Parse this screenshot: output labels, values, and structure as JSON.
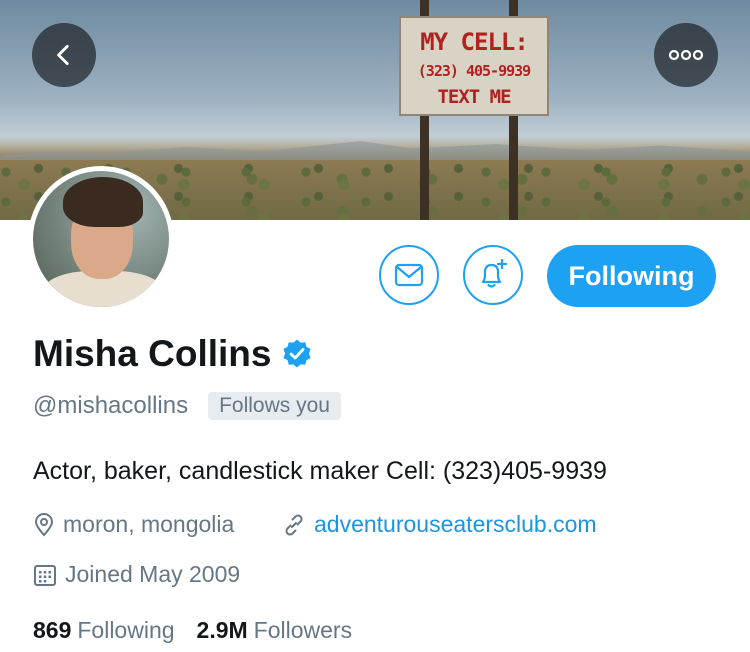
{
  "banner": {
    "sign_line1": "MY CELL:",
    "sign_line2": "(323) 405-9939",
    "sign_line3": "TEXT ME"
  },
  "header": {
    "back_icon": "chevron-left-icon",
    "more_icon": "more-horizontal-icon"
  },
  "actions": {
    "message_icon": "envelope-icon",
    "notify_icon": "bell-plus-icon",
    "following_label": "Following"
  },
  "profile": {
    "name": "Misha Collins",
    "handle": "@mishacollins",
    "follows_you": "Follows you",
    "bio": "Actor, baker, candlestick maker Cell: (323)405-9939",
    "location": "moron, mongolia",
    "website": "adventurouseatersclub.com",
    "joined": "Joined May 2009"
  },
  "stats": {
    "following_count": "869",
    "following_label": "Following",
    "followers_count": "2.9M",
    "followers_label": "Followers"
  },
  "colors": {
    "accent": "#1da1f2",
    "link": "#1b95e0",
    "secondary_text": "#657786"
  }
}
